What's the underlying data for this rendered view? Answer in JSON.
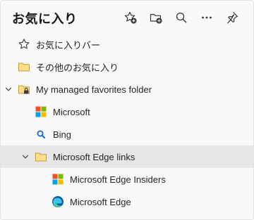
{
  "header": {
    "title": "お気に入り",
    "toolbar": [
      {
        "name": "add-favorite-button",
        "icon": "star-plus-icon"
      },
      {
        "name": "add-folder-button",
        "icon": "folder-plus-icon"
      },
      {
        "name": "search-favorites-button",
        "icon": "search-icon"
      },
      {
        "name": "more-options-button",
        "icon": "more-horizontal-icon"
      },
      {
        "name": "pin-favorites-button",
        "icon": "pin-icon"
      }
    ]
  },
  "tree": {
    "items": [
      {
        "label": "お気に入りバー",
        "icon": "star-outline-icon",
        "level": 0,
        "expandable": false
      },
      {
        "label": "その他のお気に入り",
        "icon": "folder-icon",
        "level": 0,
        "expandable": false
      },
      {
        "label": "My managed favorites folder",
        "icon": "managed-folder-icon",
        "level": 0,
        "expandable": true,
        "expanded": true
      },
      {
        "label": "Microsoft",
        "icon": "microsoft-logo-icon",
        "level": 1,
        "expandable": false
      },
      {
        "label": "Bing",
        "icon": "bing-search-icon",
        "level": 1,
        "expandable": false
      },
      {
        "label": "Microsoft Edge links",
        "icon": "folder-icon",
        "level": 1,
        "expandable": true,
        "expanded": true,
        "selected": true
      },
      {
        "label": "Microsoft Edge Insiders",
        "icon": "microsoft-logo-icon",
        "level": 2,
        "expandable": false
      },
      {
        "label": "Microsoft Edge",
        "icon": "edge-logo-icon",
        "level": 2,
        "expandable": false
      }
    ]
  },
  "colors": {
    "panel_bg": "#f9f9f9",
    "selected_row": "#e6e6e6",
    "folder_fill": "#ffe08a",
    "folder_stroke": "#c99a2e",
    "bing_blue": "#0f6cbd",
    "ms_red": "#f25022",
    "ms_green": "#7fba00",
    "ms_blue": "#00a4ef",
    "ms_yellow": "#ffb900"
  }
}
